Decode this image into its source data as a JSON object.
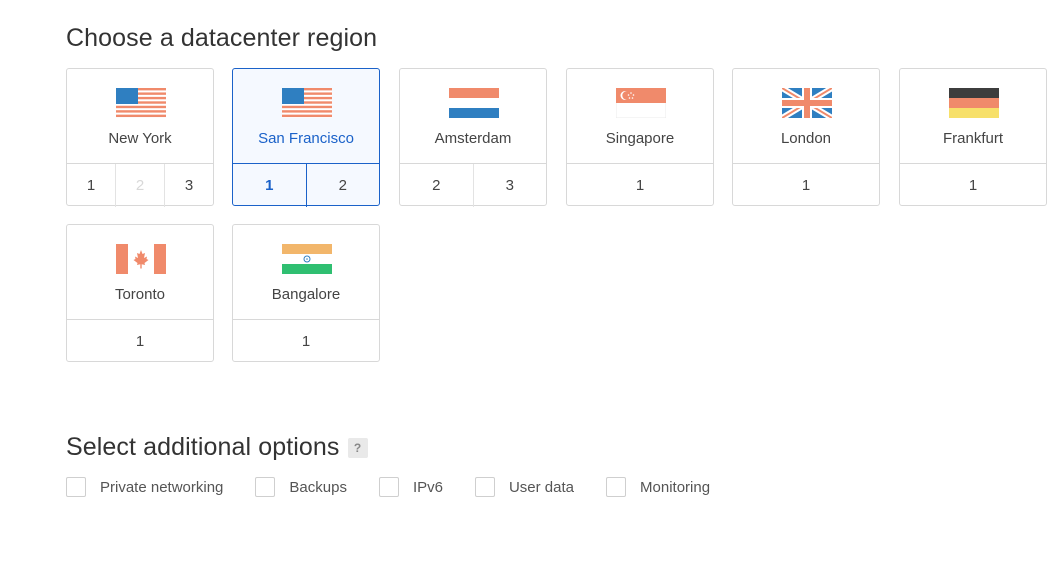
{
  "regions_section": {
    "title": "Choose a datacenter region"
  },
  "regions": [
    {
      "name": "New York",
      "flag": "us-flag",
      "datacenters": [
        {
          "label": "1",
          "disabled": false,
          "active": false
        },
        {
          "label": "2",
          "disabled": true,
          "active": false
        },
        {
          "label": "3",
          "disabled": false,
          "active": false
        }
      ],
      "selected": false
    },
    {
      "name": "San Francisco",
      "flag": "us-flag",
      "datacenters": [
        {
          "label": "1",
          "disabled": false,
          "active": true
        },
        {
          "label": "2",
          "disabled": false,
          "active": false
        }
      ],
      "selected": true
    },
    {
      "name": "Amsterdam",
      "flag": "nl-flag",
      "datacenters": [
        {
          "label": "2",
          "disabled": false,
          "active": false
        },
        {
          "label": "3",
          "disabled": false,
          "active": false
        }
      ],
      "selected": false
    },
    {
      "name": "Singapore",
      "flag": "sg-flag",
      "datacenters": [
        {
          "label": "1",
          "disabled": false,
          "active": false
        }
      ],
      "selected": false
    },
    {
      "name": "London",
      "flag": "uk-flag",
      "datacenters": [
        {
          "label": "1",
          "disabled": false,
          "active": false
        }
      ],
      "selected": false
    },
    {
      "name": "Frankfurt",
      "flag": "de-flag",
      "datacenters": [
        {
          "label": "1",
          "disabled": false,
          "active": false
        }
      ],
      "selected": false
    },
    {
      "name": "Toronto",
      "flag": "ca-flag",
      "datacenters": [
        {
          "label": "1",
          "disabled": false,
          "active": false
        }
      ],
      "selected": false
    },
    {
      "name": "Bangalore",
      "flag": "in-flag",
      "datacenters": [
        {
          "label": "1",
          "disabled": false,
          "active": false
        }
      ],
      "selected": false
    }
  ],
  "options_section": {
    "title": "Select additional options",
    "help_label": "?"
  },
  "options": [
    {
      "label": "Private networking",
      "checked": false
    },
    {
      "label": "Backups",
      "checked": false
    },
    {
      "label": "IPv6",
      "checked": false
    },
    {
      "label": "User data",
      "checked": false
    },
    {
      "label": "Monitoring",
      "checked": false
    }
  ],
  "colors": {
    "accent": "#1b62c9",
    "border": "#d8d8d8",
    "flag_blue": "#2f7fc1",
    "flag_red": "#f08a6b"
  }
}
